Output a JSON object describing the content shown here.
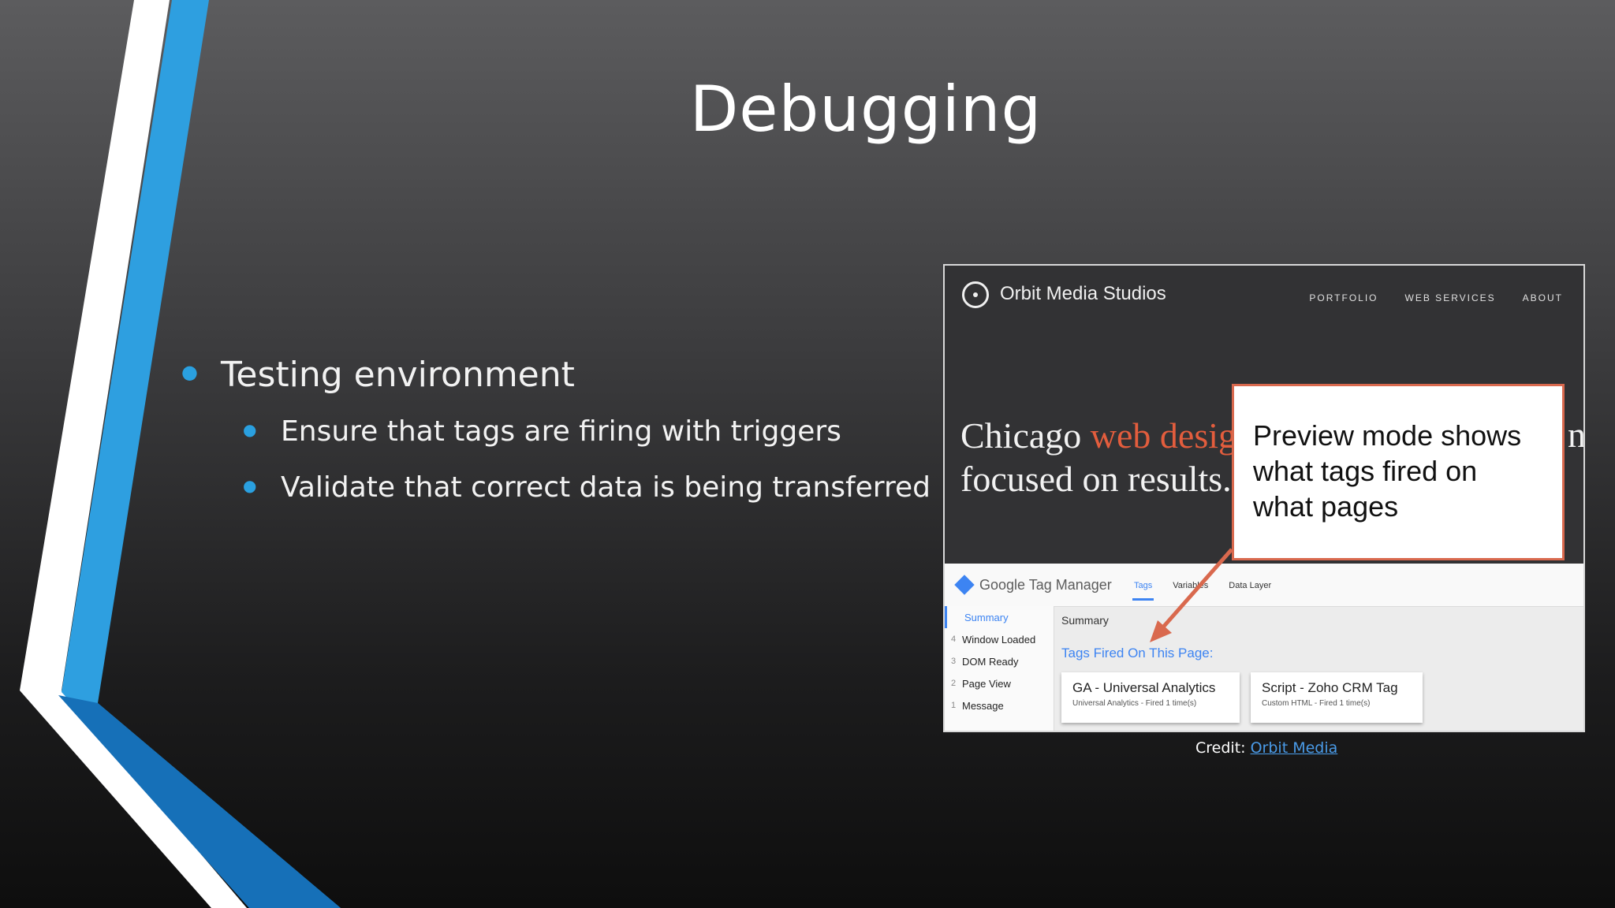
{
  "slide": {
    "title": "Debugging",
    "bullets": {
      "main": "Testing environment",
      "sub": [
        "Ensure that tags are firing with triggers",
        "Validate that correct data is being transferred"
      ]
    },
    "accent_color": "#2aa0e0"
  },
  "screenshot": {
    "site": {
      "logo_text": "Orbit Media Studios",
      "nav": [
        "PORTFOLIO",
        "WEB SERVICES",
        "ABOUT"
      ],
      "hero_line1_a": "Chicago ",
      "hero_line1_b": "web desig",
      "hero_line2": "focused on results.",
      "hero_tail": "n"
    },
    "callout_text": "Preview mode shows what tags fired on what pages",
    "gtm": {
      "app_name": "Google Tag Manager",
      "tabs": [
        "Tags",
        "Variables",
        "Data Layer"
      ],
      "sidebar": [
        {
          "num": "",
          "label": "Summary"
        },
        {
          "num": "4",
          "label": "Window Loaded"
        },
        {
          "num": "3",
          "label": "DOM Ready"
        },
        {
          "num": "2",
          "label": "Page View"
        },
        {
          "num": "1",
          "label": "Message"
        }
      ],
      "summary_heading": "Summary",
      "fired_heading": "Tags Fired On This Page:",
      "cards": [
        {
          "title": "GA - Universal Analytics",
          "sub": "Universal Analytics - Fired 1 time(s)"
        },
        {
          "title": "Script - Zoho CRM Tag",
          "sub": "Custom HTML - Fired 1 time(s)"
        }
      ]
    }
  },
  "credit": {
    "label": "Credit: ",
    "link_text": "Orbit Media"
  }
}
